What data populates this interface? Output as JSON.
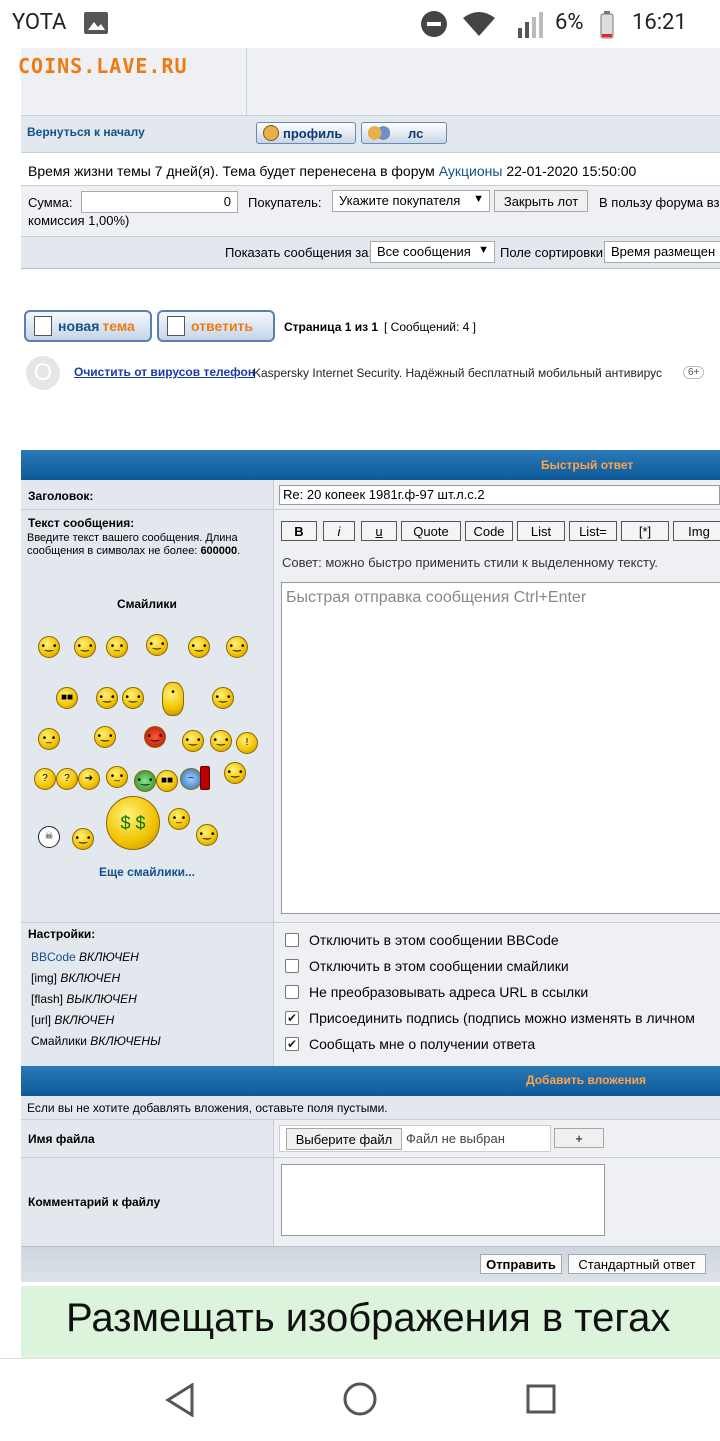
{
  "status_bar": {
    "carrier": "YOTA",
    "battery": "6%",
    "time": "16:21"
  },
  "site": {
    "logo": "COINS.LAVE.RU"
  },
  "post_actions": {
    "back_to_top": "Вернуться к началу",
    "profile_button": "профиль",
    "pm_button": "лс"
  },
  "topic_info": {
    "lifetime_prefix": "Время жизни темы 7 дней(я). Тема будет перенесена в форум",
    "forum_link": "Аукционы",
    "date": "22-01-2020 15:50:00"
  },
  "lot_form": {
    "sum_label": "Сумма:",
    "sum_value": "0",
    "buyer_label": "Покупатель:",
    "buyer_select": "Укажите покупателя",
    "close_lot_button": "Закрыть лот",
    "forum_note": "В пользу форума вз",
    "commission": "комиссия 1,00%)"
  },
  "display_options": {
    "show_label": "Показать сообщения за:",
    "show_value": "Все сообщения",
    "sort_label": "Поле сортировки",
    "sort_value": "Время размещен"
  },
  "toolbar": {
    "new_topic_a": "новая",
    "new_topic_b": "тема",
    "reply": "ответить",
    "page_info": "Страница 1 из 1",
    "message_count": "[ Сообщений: 4 ]"
  },
  "ad": {
    "badge": "O",
    "link": "Очистить от вирусов телефон",
    "text": "Kaspersky Internet Security. Надёжный бесплатный мобильный антивирус",
    "age": "6+"
  },
  "quick_reply": {
    "header": "Быстрый ответ",
    "subject_label": "Заголовок:",
    "subject_value": "Re: 20 копеек 1981г.ф-97 шт.л.с.2",
    "message_label": "Текст сообщения:",
    "message_hint": "Введите текст вашего сообщения. Длина сообщения в символах не более:",
    "message_max": "600000",
    "smilies_title": "Смайлики",
    "more_smilies": "Еще смайлики...",
    "bbcode_buttons": [
      "B",
      "i",
      "u",
      "Quote",
      "Code",
      "List",
      "List=",
      "[*]",
      "Img"
    ],
    "tip": "Совет: можно быстро применить стили к выделенному тексту.",
    "textarea_placeholder": "Быстрая отправка сообщения Ctrl+Enter"
  },
  "settings": {
    "title": "Настройки:",
    "items": [
      {
        "name": "BBCode",
        "state": "ВКЛЮЧЕН"
      },
      {
        "name": "[img]",
        "state": "ВКЛЮЧЕН"
      },
      {
        "name": "[flash]",
        "state": "ВЫКЛЮЧЕН"
      },
      {
        "name": "[url]",
        "state": "ВКЛЮЧЕН"
      },
      {
        "name": "Смайлики",
        "state": "ВКЛЮЧЕНЫ"
      }
    ],
    "options": [
      {
        "label": "Отключить в этом сообщении BBCode",
        "checked": false
      },
      {
        "label": "Отключить в этом сообщении смайлики",
        "checked": false
      },
      {
        "label": "Не преобразовывать адреса URL в ссылки",
        "checked": false
      },
      {
        "label": "Присоединить подпись (подпись можно изменять в личном",
        "checked": true
      },
      {
        "label": "Сообщать мне о получении ответа",
        "checked": true
      }
    ]
  },
  "attachments": {
    "header": "Добавить вложения",
    "hint": "Если вы не хотите добавлять вложения, оставьте поля пустыми.",
    "filename_label": "Имя файла",
    "choose_file": "Выберите файл",
    "no_file": "Файл не выбран",
    "add_button": "+",
    "comment_label": "Комментарий к файлу"
  },
  "submit": {
    "send": "Отправить",
    "standard_reply": "Стандартный ответ"
  },
  "banner": {
    "text": "Размещать изображения в тегах"
  },
  "colors": {
    "link": "#105289",
    "header_gradient_top": "#2b79b8",
    "header_text": "#ffa34d",
    "banner_bg": "#dcf3dc",
    "logo": "#f07a12"
  }
}
